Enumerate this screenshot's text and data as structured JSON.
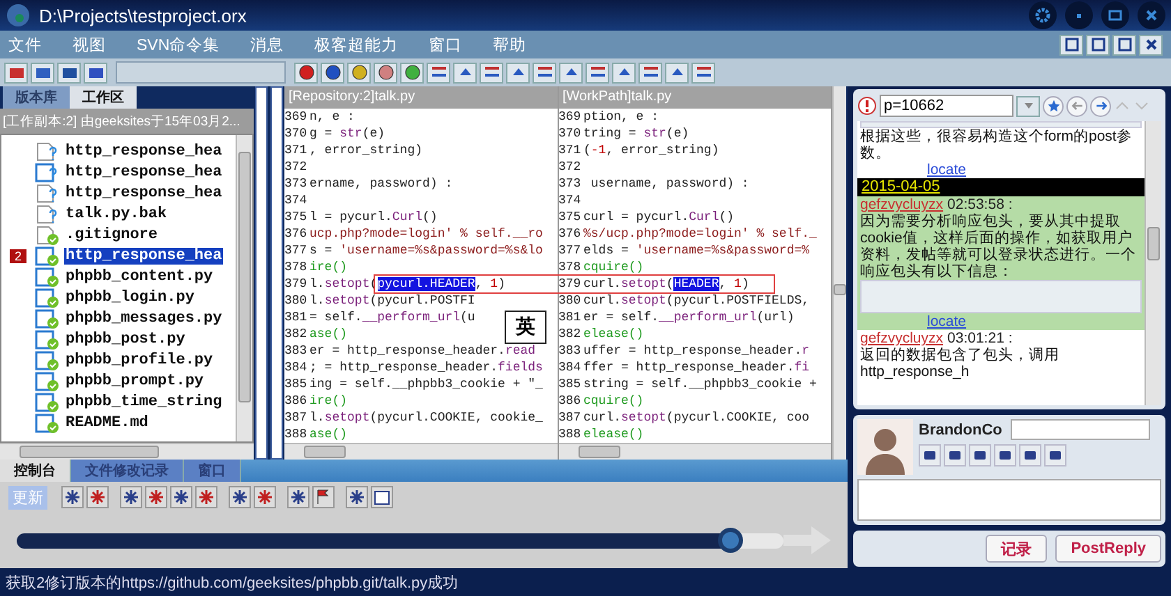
{
  "window": {
    "title": "D:\\Projects\\testproject.orx"
  },
  "menu": [
    "文件",
    "视图",
    "SVN命令集",
    "消息",
    "极客超能力",
    "窗口",
    "帮助"
  ],
  "left_panel": {
    "tabs": [
      {
        "label": "版本库",
        "selected": false
      },
      {
        "label": "工作区",
        "selected": true
      }
    ],
    "path": "[工作副本:2] 由geeksites于15年03月2...",
    "tree": [
      {
        "name": "http_response_hea",
        "kind": "newfile",
        "selected": false
      },
      {
        "name": "http_response_hea",
        "kind": "newmodule",
        "selected": false
      },
      {
        "name": "http_response_hea",
        "kind": "newfile",
        "selected": false
      },
      {
        "name": "talk.py.bak",
        "kind": "newfile",
        "selected": false
      },
      {
        "name": ".gitignore",
        "kind": "file",
        "selected": false
      },
      {
        "name": "http_response_hea",
        "kind": "module",
        "selected": true,
        "badge": "2"
      },
      {
        "name": "phpbb_content.py",
        "kind": "module",
        "selected": false
      },
      {
        "name": "phpbb_login.py",
        "kind": "module",
        "selected": false
      },
      {
        "name": "phpbb_messages.py",
        "kind": "module",
        "selected": false
      },
      {
        "name": "phpbb_post.py",
        "kind": "module",
        "selected": false
      },
      {
        "name": "phpbb_profile.py",
        "kind": "module",
        "selected": false
      },
      {
        "name": "phpbb_prompt.py",
        "kind": "module",
        "selected": false
      },
      {
        "name": "phpbb_time_string",
        "kind": "module",
        "selected": false
      },
      {
        "name": "README.md",
        "kind": "module",
        "selected": false
      }
    ]
  },
  "diff": {
    "ime": "英",
    "panes": [
      {
        "title": "[Repository:2]talk.py",
        "lines": [
          {
            "num": "369",
            "parts": [
              {
                "text": "n, e :",
                "kind": "plain"
              }
            ]
          },
          {
            "num": "370",
            "parts": [
              {
                "text": "g = ",
                "kind": "plain"
              },
              {
                "text": "str",
                "kind": "call"
              },
              {
                "text": "(e)",
                "kind": "plain"
              }
            ]
          },
          {
            "num": "371",
            "parts": [
              {
                "text": ", error_string)",
                "kind": "plain"
              }
            ]
          },
          {
            "num": "372"
          },
          {
            "num": "373",
            "parts": [
              {
                "text": "ername, password) :",
                "kind": "plain"
              }
            ]
          },
          {
            "num": "374"
          },
          {
            "num": "375",
            "parts": [
              {
                "text": "l = pycurl.",
                "kind": "plain"
              },
              {
                "text": "Curl",
                "kind": "call"
              },
              {
                "text": "()",
                "kind": "plain"
              }
            ]
          },
          {
            "num": "376",
            "parts": [
              {
                "text": "ucp.php?mode=login' % self.__ro",
                "kind": "string"
              }
            ]
          },
          {
            "num": "377",
            "parts": [
              {
                "text": "s = ",
                "kind": "plain"
              },
              {
                "text": "'username=%s&password=%s&lo",
                "kind": "string"
              }
            ]
          },
          {
            "num": "378",
            "parts": [
              {
                "text": "ire()",
                "kind": "lock"
              }
            ]
          },
          {
            "num": "379",
            "parts": [
              {
                "text": "l.",
                "kind": "plain"
              },
              {
                "text": "setopt",
                "kind": "call"
              },
              {
                "text": "(",
                "kind": "plain"
              },
              {
                "text": "pycurl.HEADER",
                "kind": "selection"
              },
              {
                "text": ", ",
                "kind": "plain"
              },
              {
                "text": "1",
                "kind": "number"
              },
              {
                "text": ")",
                "kind": "plain"
              }
            ]
          },
          {
            "num": "380",
            "parts": [
              {
                "text": "l.",
                "kind": "plain"
              },
              {
                "text": "setopt",
                "kind": "call"
              },
              {
                "text": "(pycurl.POSTFI",
                "kind": "plain"
              }
            ]
          },
          {
            "num": "381",
            "parts": [
              {
                "text": "= self.",
                "kind": "plain"
              },
              {
                "text": "__perform_url",
                "kind": "call"
              },
              {
                "text": "(u",
                "kind": "plain"
              }
            ]
          },
          {
            "num": "382",
            "parts": [
              {
                "text": "ase()",
                "kind": "lock"
              }
            ]
          },
          {
            "num": "383",
            "parts": [
              {
                "text": "er = http_response_header.",
                "kind": "plain"
              },
              {
                "text": "read",
                "kind": "call"
              }
            ]
          },
          {
            "num": "384",
            "parts": [
              {
                "text": "; = http_response_header.",
                "kind": "plain"
              },
              {
                "text": "fields",
                "kind": "call"
              }
            ]
          },
          {
            "num": "385",
            "parts": [
              {
                "text": "ing = self.__phpbb3_cookie + \"_",
                "kind": "plain"
              }
            ]
          },
          {
            "num": "386",
            "parts": [
              {
                "text": "ire()",
                "kind": "lock"
              }
            ]
          },
          {
            "num": "387",
            "parts": [
              {
                "text": "l.",
                "kind": "plain"
              },
              {
                "text": "setopt",
                "kind": "call"
              },
              {
                "text": "(pycurl.COOKIE, cookie_",
                "kind": "plain"
              }
            ]
          },
          {
            "num": "388",
            "parts": [
              {
                "text": "ase()",
                "kind": "lock"
              }
            ]
          }
        ]
      },
      {
        "title": "[WorkPath]talk.py",
        "lines": [
          {
            "num": "369",
            "parts": [
              {
                "text": "ption, e :",
                "kind": "plain"
              }
            ]
          },
          {
            "num": "370",
            "parts": [
              {
                "text": "tring = ",
                "kind": "plain"
              },
              {
                "text": "str",
                "kind": "call"
              },
              {
                "text": "(e)",
                "kind": "plain"
              }
            ]
          },
          {
            "num": "371",
            "parts": [
              {
                "text": "(",
                "kind": "plain"
              },
              {
                "text": "-1",
                "kind": "number"
              },
              {
                "text": ", error_string)",
                "kind": "plain"
              }
            ]
          },
          {
            "num": "372"
          },
          {
            "num": "373",
            "parts": [
              {
                "text": " username, password) :",
                "kind": "plain"
              }
            ]
          },
          {
            "num": "374"
          },
          {
            "num": "375",
            "parts": [
              {
                "text": "curl = pycurl.",
                "kind": "plain"
              },
              {
                "text": "Curl",
                "kind": "call"
              },
              {
                "text": "()",
                "kind": "plain"
              }
            ]
          },
          {
            "num": "376",
            "parts": [
              {
                "text": "%s/ucp.php?mode=login' % self._",
                "kind": "string"
              }
            ]
          },
          {
            "num": "377",
            "parts": [
              {
                "text": "elds = ",
                "kind": "plain"
              },
              {
                "text": "'username=%s&password=%",
                "kind": "string"
              }
            ]
          },
          {
            "num": "378",
            "parts": [
              {
                "text": "cquire()",
                "kind": "lock"
              }
            ]
          },
          {
            "num": "379",
            "parts": [
              {
                "text": "curl.",
                "kind": "plain"
              },
              {
                "text": "setopt",
                "kind": "call"
              },
              {
                "text": "(",
                "kind": "plain"
              },
              {
                "text": "HEADER",
                "kind": "selection"
              },
              {
                "text": ", ",
                "kind": "plain"
              },
              {
                "text": "1",
                "kind": "number"
              },
              {
                "text": ")",
                "kind": "plain"
              }
            ]
          },
          {
            "num": "380",
            "parts": [
              {
                "text": "curl.",
                "kind": "plain"
              },
              {
                "text": "setopt",
                "kind": "call"
              },
              {
                "text": "(pycurl.POSTFIELDS,",
                "kind": "plain"
              }
            ]
          },
          {
            "num": "381",
            "parts": [
              {
                "text": "er = self.",
                "kind": "plain"
              },
              {
                "text": "__perform_url",
                "kind": "call"
              },
              {
                "text": "(url)",
                "kind": "plain"
              }
            ]
          },
          {
            "num": "382",
            "parts": [
              {
                "text": "elease()",
                "kind": "lock"
              }
            ]
          },
          {
            "num": "383",
            "parts": [
              {
                "text": "uffer = http_response_header.",
                "kind": "plain"
              },
              {
                "text": "r",
                "kind": "call"
              }
            ]
          },
          {
            "num": "384",
            "parts": [
              {
                "text": "ffer = http_response_header.",
                "kind": "plain"
              },
              {
                "text": "fi",
                "kind": "call"
              }
            ]
          },
          {
            "num": "385",
            "parts": [
              {
                "text": "string = self.__phpbb3_cookie +",
                "kind": "plain"
              }
            ]
          },
          {
            "num": "386",
            "parts": [
              {
                "text": "cquire()",
                "kind": "lock"
              }
            ]
          },
          {
            "num": "387",
            "parts": [
              {
                "text": "curl.",
                "kind": "plain"
              },
              {
                "text": "setopt",
                "kind": "call"
              },
              {
                "text": "(pycurl.COOKIE, coo",
                "kind": "plain"
              }
            ]
          },
          {
            "num": "388",
            "parts": [
              {
                "text": "elease()",
                "kind": "lock"
              }
            ]
          }
        ]
      }
    ]
  },
  "chat": {
    "address": "p=10662",
    "messages": [
      {
        "kind": "image",
        "highlighted": false
      },
      {
        "kind": "text",
        "text": "根据这些，很容易构造这个form的post参数。",
        "highlighted": false
      },
      {
        "kind": "link",
        "text": "locate",
        "highlighted": false
      },
      {
        "kind": "date",
        "text": "2015-04-05",
        "highlighted": false
      },
      {
        "kind": "header",
        "author": "gefzvycluyzx",
        "time": "02:53:58 :",
        "highlighted": true
      },
      {
        "kind": "text",
        "text": "因为需要分析响应包头，要从其中提取cookie值，这样后面的操作，如获取用户资料，发帖等就可以登录状态进行。一个响应包头有以下信息：",
        "highlighted": true
      },
      {
        "kind": "image",
        "highlighted": true
      },
      {
        "kind": "link",
        "text": "locate",
        "highlighted": true
      },
      {
        "kind": "header",
        "author": "gefzvycluyzx",
        "time": "03:01:21 :",
        "highlighted": false
      },
      {
        "kind": "text",
        "text": "返回的数据包含了包头，调用http_response_h",
        "highlighted": false
      }
    ],
    "user": "BrandonCo",
    "buttons": [
      "记录",
      "PostReply"
    ]
  },
  "console": {
    "tabs": [
      {
        "label": "控制台",
        "selected": true
      },
      {
        "label": "文件修改记录",
        "selected": false
      },
      {
        "label": "窗口",
        "selected": false
      }
    ],
    "update_button": "更新",
    "progress": {
      "level": 0.93
    }
  },
  "status_bar": "获取2修订版本的https://github.com/geeksites/phpbb.git/talk.py成功"
}
